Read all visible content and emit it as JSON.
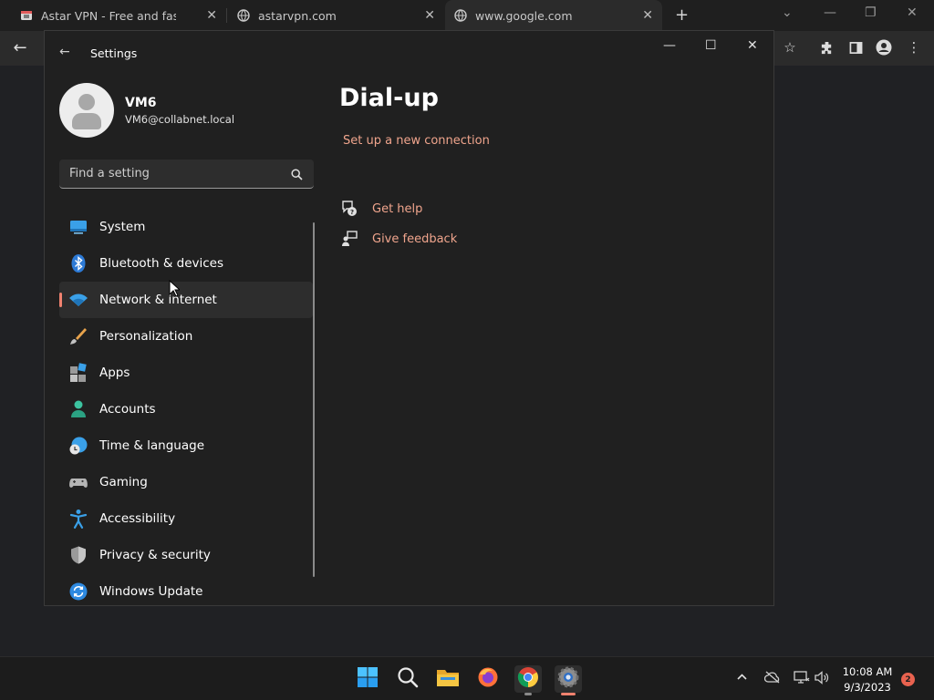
{
  "browser": {
    "tabs": [
      {
        "title": "Astar VPN - Free and fast VPN fo",
        "favicon": "astar-vpn-icon"
      },
      {
        "title": "astarvpn.com",
        "favicon": "globe-icon"
      },
      {
        "title": "www.google.com",
        "favicon": "globe-icon"
      }
    ],
    "new_tab_glyph": "+",
    "close_glyph": "✕"
  },
  "settings": {
    "window_title": "Settings",
    "user": {
      "name": "VM6",
      "email": "VM6@collabnet.local"
    },
    "search": {
      "placeholder": "Find a setting"
    },
    "nav": [
      {
        "label": "System",
        "icon": "system-icon",
        "selected": false
      },
      {
        "label": "Bluetooth & devices",
        "icon": "bluetooth-icon",
        "selected": false
      },
      {
        "label": "Network & internet",
        "icon": "wifi-icon",
        "selected": true
      },
      {
        "label": "Personalization",
        "icon": "brush-icon",
        "selected": false
      },
      {
        "label": "Apps",
        "icon": "apps-icon",
        "selected": false
      },
      {
        "label": "Accounts",
        "icon": "accounts-icon",
        "selected": false
      },
      {
        "label": "Time & language",
        "icon": "time-language-icon",
        "selected": false
      },
      {
        "label": "Gaming",
        "icon": "gaming-icon",
        "selected": false
      },
      {
        "label": "Accessibility",
        "icon": "accessibility-icon",
        "selected": false
      },
      {
        "label": "Privacy & security",
        "icon": "shield-icon",
        "selected": false
      },
      {
        "label": "Windows Update",
        "icon": "windows-update-icon",
        "selected": false
      }
    ],
    "page": {
      "title": "Dial-up",
      "setup_link": "Set up a new connection",
      "get_help": "Get help",
      "give_feedback": "Give feedback"
    },
    "accent_color": "#f0a58d"
  },
  "taskbar": {
    "apps": [
      "start-icon",
      "search-icon",
      "file-explorer-icon",
      "firefox-icon",
      "chrome-icon",
      "settings-icon"
    ],
    "time": "10:08 AM",
    "date": "9/3/2023",
    "notification_count": "2"
  }
}
